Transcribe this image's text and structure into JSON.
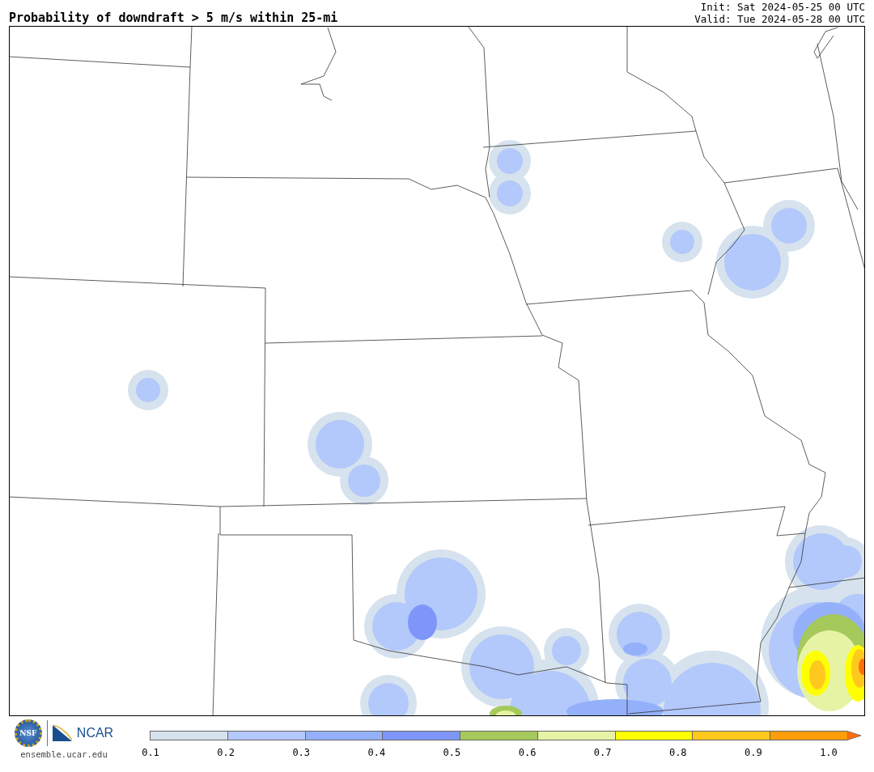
{
  "title": "Probability of downdraft > 5 m/s within 25-mi",
  "init": "Init: Sat 2024-05-25 00 UTC",
  "valid": "Valid: Tue 2024-05-28 00 UTC",
  "logo": {
    "nsf": "NSF",
    "ncar": "NCAR",
    "url": "ensemble.ucar.edu"
  },
  "colorbar": {
    "bins": [
      {
        "color": "#d6e2ed"
      },
      {
        "color": "#b3c8fb"
      },
      {
        "color": "#94b0fa"
      },
      {
        "color": "#7e96fa"
      },
      {
        "color": "#a5c95a"
      },
      {
        "color": "#e6f3a5"
      },
      {
        "color": "#ffff00"
      },
      {
        "color": "#ffc81e"
      },
      {
        "color": "#ff9e0a"
      },
      {
        "kind": "arrow",
        "color": "#ff6e0a"
      }
    ],
    "ticks": [
      "0.1",
      "0.2",
      "0.3",
      "0.4",
      "0.5",
      "0.6",
      "0.7",
      "0.8",
      "0.9",
      "1.0"
    ]
  }
}
